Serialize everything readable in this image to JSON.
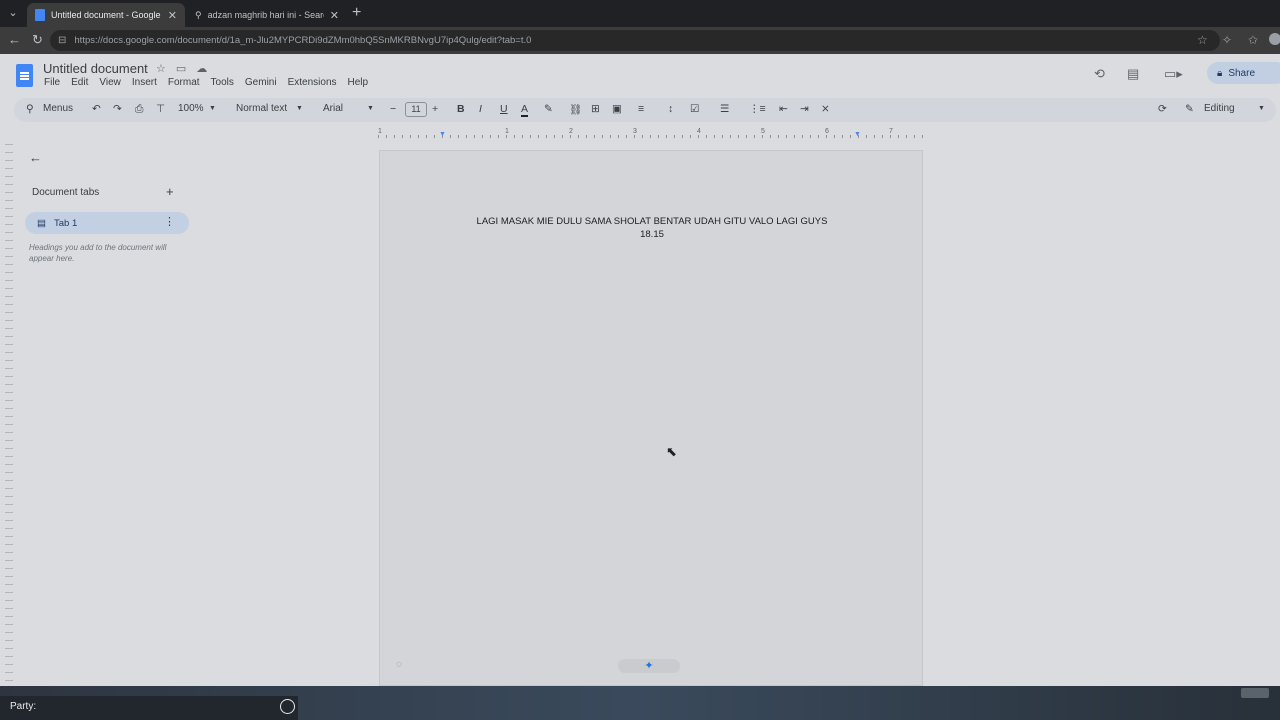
{
  "browser": {
    "tabs": [
      {
        "title": "Untitled document - Google Docs",
        "active": true,
        "favicon": "docs-favicon-icon"
      },
      {
        "title": "adzan maghrib hari ini - Search",
        "active": false,
        "favicon": "search-icon"
      }
    ],
    "url": "https://docs.google.com/document/d/1a_m-Jlu2MYPCRDi9dZMm0hbQ5SnMKRBNvgU7ip4Qulg/edit?tab=t.0"
  },
  "docs": {
    "title": "Untitled document",
    "menu": [
      "File",
      "Edit",
      "View",
      "Insert",
      "Format",
      "Tools",
      "Gemini",
      "Extensions",
      "Help"
    ],
    "share_label": "Share",
    "toolbar": {
      "menus_label": "Menus",
      "zoom": "100%",
      "style": "Normal text",
      "font": "Arial",
      "font_size": "11",
      "mode": "Editing"
    },
    "ruler_numbers": [
      "1",
      "1",
      "2",
      "3",
      "4",
      "5",
      "6",
      "7"
    ],
    "sidebar": {
      "section_label": "Document tabs",
      "tab_label": "Tab 1",
      "hint": "Headings you add to the document will appear here."
    },
    "body_lines": [
      "LAGI MASAK MIE DULU SAMA SHOLAT BENTAR UDAH GITU VALO LAGI GUYS",
      "18.15"
    ]
  },
  "taskbar": {
    "party_label": "Party:"
  },
  "colors": {
    "docs_blue": "#4285f4",
    "share_bg": "#c2cfe3",
    "accent_blue": "#1a73e8"
  }
}
